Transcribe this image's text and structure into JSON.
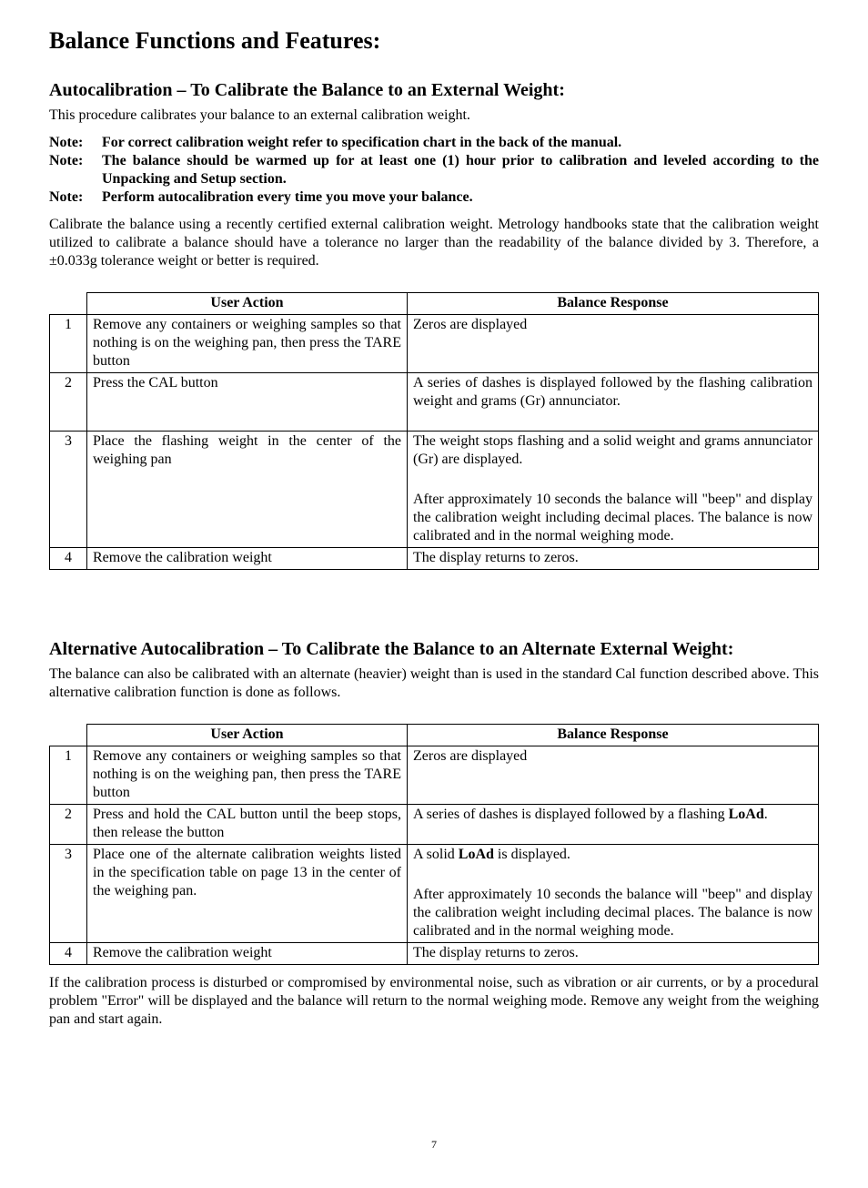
{
  "title": "Balance Functions and Features:",
  "section1": {
    "heading": "Autocalibration – To Calibrate the Balance to an External Weight:",
    "intro": "This procedure calibrates your balance to an external calibration weight.",
    "notes": [
      {
        "label": "Note:",
        "text": "For correct calibration weight refer to specification chart in the back of the manual."
      },
      {
        "label": "Note:",
        "text": "The balance should be warmed up for at least one (1) hour prior to calibration and leveled according to the Unpacking and Setup section."
      },
      {
        "label": "Note:",
        "text": "Perform autocalibration every time you move your balance."
      }
    ],
    "para": "Calibrate the balance using a recently certified external calibration weight.  Metrology handbooks state that the calibration weight utilized to calibrate a balance should have a tolerance no larger than the readability of the balance divided by 3.  Therefore, a ±0.033g tolerance weight or better is required.",
    "tableHeaders": {
      "action": "User Action",
      "response": "Balance Response"
    },
    "rows": [
      {
        "n": "1",
        "action": "Remove any containers or weighing samples so that nothing is on the weighing pan, then press the TARE button",
        "response": "Zeros are displayed"
      },
      {
        "n": "2",
        "action": "Press the CAL button",
        "response": "A series of dashes is displayed followed by the flashing calibration weight and grams (Gr) annunciator."
      },
      {
        "n": "3",
        "action": "Place the flashing weight in the center of the weighing pan",
        "response_p1": "The weight stops flashing and a solid weight and grams annunciator (Gr) are displayed.",
        "response_p2": "After approximately 10 seconds the balance will \"beep\" and display the calibration weight including decimal places.  The balance is now calibrated and in the normal weighing mode."
      },
      {
        "n": "4",
        "action": "Remove the calibration weight",
        "response": "The display returns to zeros."
      }
    ]
  },
  "section2": {
    "heading": "Alternative Autocalibration – To Calibrate the Balance to an Alternate External Weight:",
    "intro": "The balance can also be calibrated with an alternate (heavier) weight than is used in the standard Cal function described above.  This alternative calibration function is done as follows.",
    "tableHeaders": {
      "action": "User Action",
      "response": "Balance Response"
    },
    "rows": [
      {
        "n": "1",
        "action": "Remove any containers or weighing samples so that nothing is on the weighing pan, then press the TARE button",
        "response": "Zeros are displayed"
      },
      {
        "n": "2",
        "action": "Press and hold the CAL button until the beep stops, then release the button",
        "response_pre": "A series of dashes is displayed followed by a flashing ",
        "response_bold": "LoAd",
        "response_post": "."
      },
      {
        "n": "3",
        "action": "Place one of the alternate calibration weights listed in the specification table on page 13 in the center of the weighing pan.",
        "response_p1_pre": "A solid ",
        "response_p1_bold": "LoAd",
        "response_p1_post": " is displayed.",
        "response_p2": "After approximately 10 seconds the balance will \"beep\" and display the calibration weight including decimal places.  The balance is now calibrated and in the normal weighing mode."
      },
      {
        "n": "4",
        "action": "Remove the calibration weight",
        "response": "The display returns to zeros."
      }
    ],
    "closing": "If the calibration process is disturbed or compromised by environmental noise, such as vibration or air currents, or by a procedural problem \"Error\" will be displayed and the balance will return to the normal weighing mode.  Remove any weight from the weighing pan and start again."
  },
  "pageNumber": "7"
}
